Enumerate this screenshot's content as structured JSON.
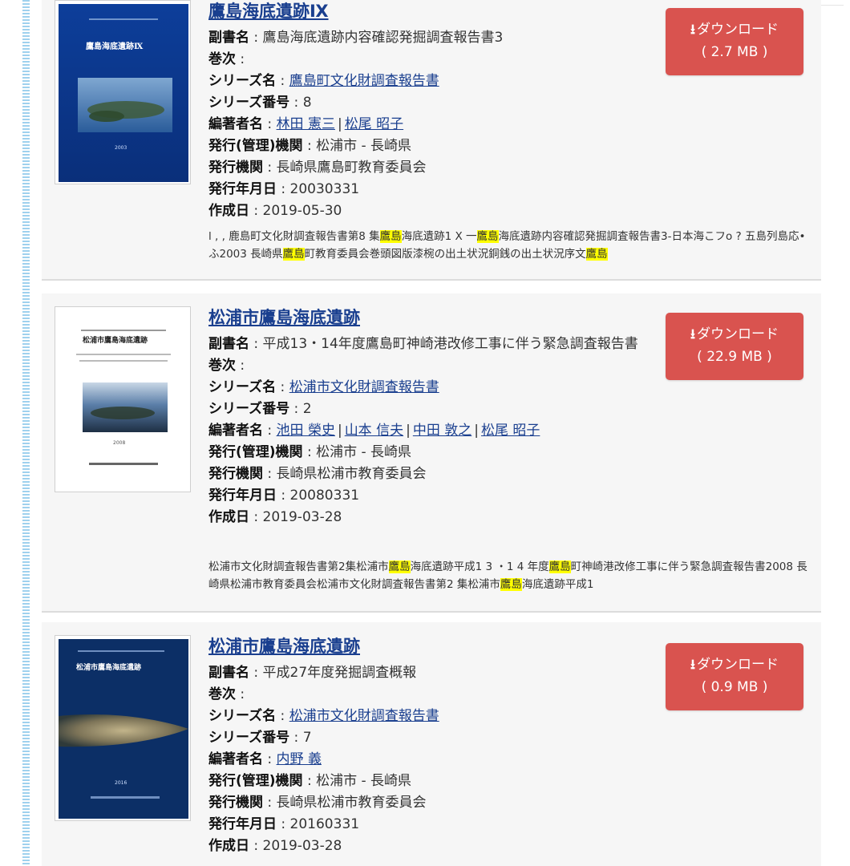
{
  "labels": {
    "subtitle": "副書名",
    "volume": "巻次",
    "series_name": "シリーズ名",
    "series_number": "シリーズ番号",
    "authors": "編著者名",
    "publisher_admin": "発行(管理)機関",
    "publisher": "発行機関",
    "pub_date": "発行年月日",
    "created": "作成日",
    "colon": " : "
  },
  "entries": [
    {
      "title": "鷹島海底遺跡Ⅸ",
      "subtitle": "鷹島海底遺跡内容確認発掘調査報告書3",
      "volume": "",
      "series_name": "鷹島町文化財調査報告書",
      "series_number": "8",
      "authors": [
        "林田 憲三",
        "松尾 昭子"
      ],
      "publisher_admin": "松浦市 - 長崎県",
      "publisher": "長崎県鷹島町教育委員会",
      "pub_date": "20030331",
      "created": "2019-05-30",
      "download_label": "ダウンロード",
      "download_size": "( 2.7 MB )",
      "cover_text": "鷹島海底遺跡Ⅸ",
      "cover_year": "2003",
      "snippet_parts": [
        "l , , 鹿島町文化財調査報告書第8 集",
        "鷹島",
        "海底遺跡1 X 一",
        "鷹島",
        "海底遺跡内容確認発掘調査報告書3-日本海こフo ? 五島列島応•ふ2003 長崎県",
        "鷹島",
        "町教育委員会巻頭図版漆椀の出土状況銅銭の出土状況序文",
        "鷹島"
      ]
    },
    {
      "title": "松浦市鷹島海底遺跡",
      "subtitle": "平成13・14年度鷹島町神崎港改修工事に伴う緊急調査報告書",
      "volume": "",
      "series_name": "松浦市文化財調査報告書",
      "series_number": "2",
      "authors": [
        "池田 榮史",
        "山本 信夫",
        "中田 敦之",
        "松尾 昭子"
      ],
      "publisher_admin": "松浦市 - 長崎県",
      "publisher": "長崎県松浦市教育委員会",
      "pub_date": "20080331",
      "created": "2019-03-28",
      "download_label": "ダウンロード",
      "download_size": "( 22.9 MB )",
      "cover_text": "松浦市鷹島海底遺跡",
      "cover_year": "2008",
      "snippet_parts": [
        "松浦市文化財調査報告書第2集松浦市",
        "鷹島",
        "海底遺跡平成1 3 ・1 4 年度",
        "鷹島",
        "町神崎港改修工事に伴う緊急調査報告書2008 長崎県松浦市教育委員会松浦市文化財調査報告書第2 集松浦市",
        "鷹島",
        "海底遺跡平成1",
        ""
      ]
    },
    {
      "title": "松浦市鷹島海底遺跡",
      "subtitle": "平成27年度発掘調査概報",
      "volume": "",
      "series_name": "松浦市文化財調査報告書",
      "series_number": "7",
      "authors": [
        "内野 義"
      ],
      "publisher_admin": "松浦市 - 長崎県",
      "publisher": "長崎県松浦市教育委員会",
      "pub_date": "20160331",
      "created": "2019-03-28",
      "download_label": "ダウンロード",
      "download_size": "( 0.9 MB )",
      "cover_text": "松浦市鷹島海底遺跡",
      "cover_year": "2016"
    }
  ],
  "colors": {
    "download_button": "#d9534f",
    "link": "#1a3f8f",
    "highlight": "#ffff00",
    "entry_bg": "#f6f6f6"
  },
  "icons": {
    "download": "download-icon"
  }
}
